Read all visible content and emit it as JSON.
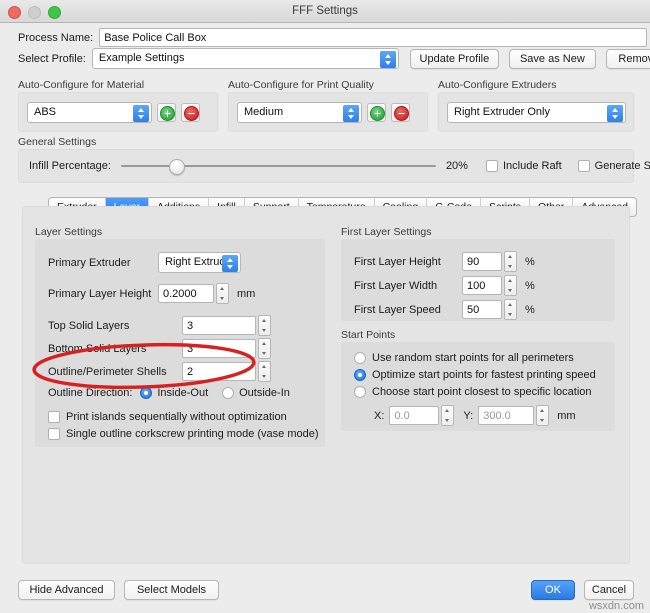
{
  "window": {
    "title": "FFF Settings",
    "traffic_lights": [
      "close-red",
      "minimize-gray",
      "zoom-green"
    ]
  },
  "header": {
    "process_name_label": "Process Name:",
    "process_name_value": "Base Police Call Box",
    "select_profile_label": "Select Profile:",
    "select_profile_value": "Example Settings",
    "update_profile_label": "Update Profile",
    "save_as_new_label": "Save as New",
    "remove_label": "Remove"
  },
  "auto_configure": {
    "material": {
      "title": "Auto-Configure for Material",
      "value": "ABS",
      "add_label": "+",
      "remove_label": "−"
    },
    "print_quality": {
      "title": "Auto-Configure for Print Quality",
      "value": "Medium",
      "add_label": "+",
      "remove_label": "−"
    },
    "extruders": {
      "title": "Auto-Configure Extruders",
      "value": "Right Extruder Only"
    }
  },
  "general_settings": {
    "title": "General Settings",
    "infill_label": "Infill Percentage:",
    "infill_value": "20%",
    "infill_percent": 20,
    "include_raft_label": "Include Raft",
    "include_raft_checked": false,
    "generate_support_label": "Generate Support",
    "generate_support_checked": false
  },
  "tabs": [
    {
      "label": "Extruder",
      "active": false
    },
    {
      "label": "Layer",
      "active": true
    },
    {
      "label": "Additions",
      "active": false
    },
    {
      "label": "Infill",
      "active": false
    },
    {
      "label": "Support",
      "active": false
    },
    {
      "label": "Temperature",
      "active": false
    },
    {
      "label": "Cooling",
      "active": false
    },
    {
      "label": "G-Code",
      "active": false
    },
    {
      "label": "Scripts",
      "active": false
    },
    {
      "label": "Other",
      "active": false
    },
    {
      "label": "Advanced",
      "active": false
    }
  ],
  "layer_settings": {
    "title": "Layer Settings",
    "primary_extruder_label": "Primary Extruder",
    "primary_extruder_value": "Right Extruder",
    "primary_layer_height_label": "Primary Layer Height",
    "primary_layer_height_value": "0.2000",
    "primary_layer_height_unit": "mm",
    "top_solid_layers_label": "Top Solid Layers",
    "top_solid_layers_value": "3",
    "bottom_solid_layers_label": "Bottom Solid Layers",
    "bottom_solid_layers_value": "3",
    "outline_shells_label": "Outline/Perimeter Shells",
    "outline_shells_value": "2",
    "outline_direction_label": "Outline Direction:",
    "outline_inside_out_label": "Inside-Out",
    "outline_inside_out_selected": true,
    "outline_outside_in_label": "Outside-In",
    "outline_outside_in_selected": false,
    "print_islands_label": "Print islands sequentially without optimization",
    "print_islands_checked": false,
    "vase_mode_label": "Single outline corkscrew printing mode (vase mode)",
    "vase_mode_checked": false
  },
  "first_layer_settings": {
    "title": "First Layer Settings",
    "height_label": "First Layer Height",
    "height_value": "90",
    "height_unit": "%",
    "width_label": "First Layer Width",
    "width_value": "100",
    "width_unit": "%",
    "speed_label": "First Layer Speed",
    "speed_value": "50",
    "speed_unit": "%"
  },
  "start_points": {
    "title": "Start Points",
    "random_label": "Use random start points for all perimeters",
    "random_selected": false,
    "optimize_label": "Optimize start points for fastest printing speed",
    "optimize_selected": true,
    "specific_label": "Choose start point closest to specific location",
    "specific_selected": false,
    "x_label": "X:",
    "x_value": "0.0",
    "y_label": "Y:",
    "y_value": "300.0",
    "unit": "mm"
  },
  "footer": {
    "hide_advanced_label": "Hide Advanced",
    "select_models_label": "Select Models",
    "ok_label": "OK",
    "cancel_label": "Cancel"
  },
  "annotation": {
    "color": "#d91f1f",
    "target": "Outline/Perimeter Shells"
  },
  "watermark": "wsxdn.com"
}
